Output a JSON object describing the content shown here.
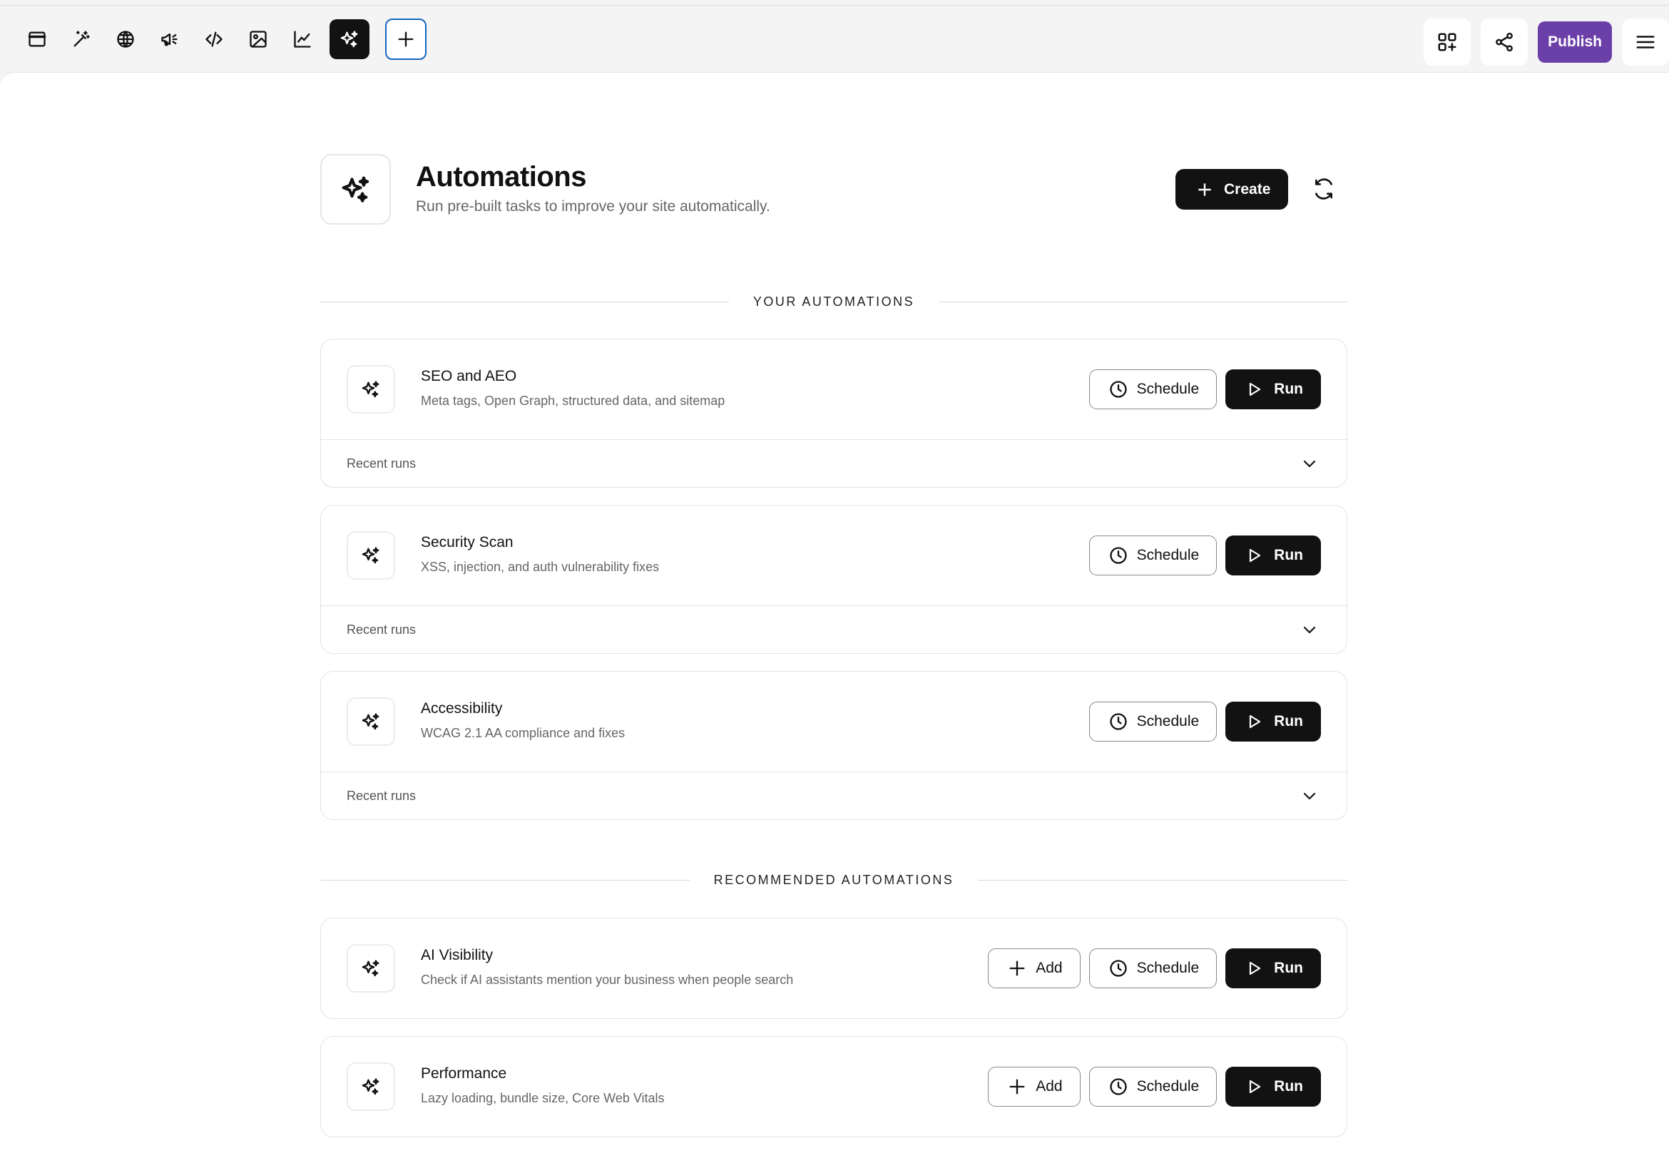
{
  "toolbar": {
    "tools": [
      {
        "icon": "browser-window-icon"
      },
      {
        "icon": "magic-wand-icon"
      },
      {
        "icon": "globe-icon"
      },
      {
        "icon": "megaphone-icon"
      },
      {
        "icon": "code-icon"
      },
      {
        "icon": "image-icon"
      },
      {
        "icon": "chart-line-icon"
      },
      {
        "icon": "sparkles-icon",
        "active": true
      },
      {
        "icon": "plus-icon"
      }
    ],
    "right": {
      "apps_icon": "apps-add-icon",
      "share_icon": "share-icon",
      "publish_label": "Publish",
      "menu_icon": "hamburger-menu-icon"
    },
    "colors": {
      "publish": "#6b3fa8",
      "add_border": "#1565c0",
      "active_bg": "#121212"
    }
  },
  "header": {
    "icon": "sparkles-icon",
    "title": "Automations",
    "subtitle": "Run pre-built tasks to improve your site automatically.",
    "create_label": "Create",
    "refresh_icon": "refresh-icon"
  },
  "sections": {
    "yours": "YOUR AUTOMATIONS",
    "recommended": "RECOMMENDED AUTOMATIONS"
  },
  "your_automations": [
    {
      "title": "SEO and AEO",
      "desc": "Meta tags, Open Graph, structured data, and sitemap",
      "schedule": "Schedule",
      "run": "Run",
      "recent": "Recent runs"
    },
    {
      "title": "Security Scan",
      "desc": "XSS, injection, and auth vulnerability fixes",
      "schedule": "Schedule",
      "run": "Run",
      "recent": "Recent runs"
    },
    {
      "title": "Accessibility",
      "desc": "WCAG 2.1 AA compliance and fixes",
      "schedule": "Schedule",
      "run": "Run",
      "recent": "Recent runs"
    }
  ],
  "recommended_automations": [
    {
      "title": "AI Visibility",
      "desc": "Check if AI assistants mention your business when people search",
      "add": "Add",
      "schedule": "Schedule",
      "run": "Run"
    },
    {
      "title": "Performance",
      "desc": "Lazy loading, bundle size, Core Web Vitals",
      "add": "Add",
      "schedule": "Schedule",
      "run": "Run"
    }
  ]
}
